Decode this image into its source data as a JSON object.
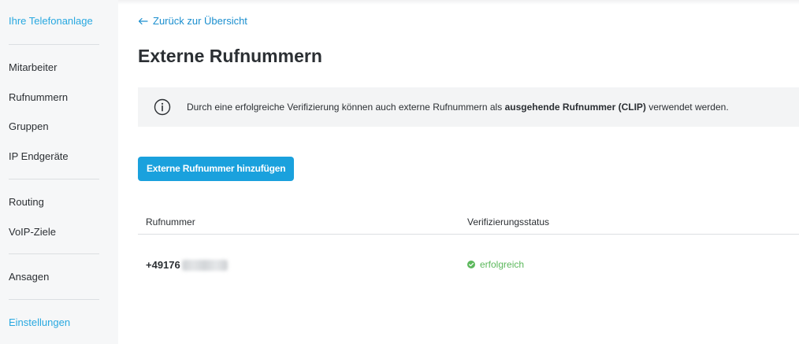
{
  "sidebar": {
    "header": "Ihre Telefonanlage",
    "items": [
      "Mitarbeiter",
      "Rufnummern",
      "Gruppen",
      "IP Endgeräte",
      "Routing",
      "VoIP-Ziele",
      "Ansagen"
    ],
    "footer": "Einstellungen"
  },
  "main": {
    "back_link": "Zurück zur Übersicht",
    "title": "Externe Rufnummern",
    "info": {
      "text_before": "Durch eine erfolgreiche Verifizierung können auch externe Rufnummern als ",
      "text_bold": "ausgehende Rufnummer (CLIP)",
      "text_after": " verwendet werden."
    },
    "add_button": "Externe Rufnummer hinzufügen",
    "table": {
      "headers": [
        "Rufnummer",
        "Verifizierungsstatus"
      ],
      "rows": [
        {
          "number_visible": "+49176",
          "status": "erfolgreich"
        }
      ]
    }
  },
  "icons": {
    "back": "arrow-left-icon",
    "info": "info-circle-icon",
    "status": "check-circle-icon"
  },
  "colors": {
    "accent": "#28a8e0",
    "button": "#1aa1dd",
    "success": "#5cb85c"
  }
}
